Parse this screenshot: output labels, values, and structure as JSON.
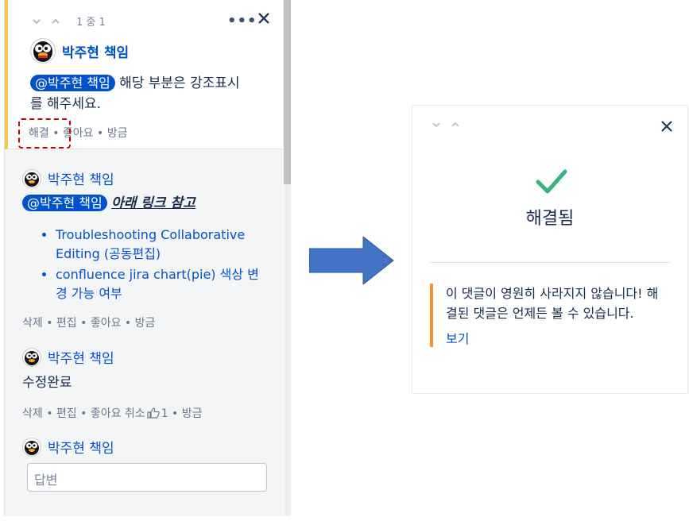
{
  "active_comment": {
    "counter": "1 중 1",
    "author": "박주현 책임",
    "mention": "@박주현 책임",
    "body": "해당 부분은 강조표시",
    "body_line2": "를 해주세요.",
    "actions": "해결 • 좋아요 • 방금"
  },
  "replies": [
    {
      "author": "박주현 책임",
      "mention": "@박주현 책임",
      "text": "아래 링크 참고",
      "links": [
        "Troubleshooting Collaborative Editing (공동편집)",
        "confluence jira chart(pie) 색상 변경 가능 여부"
      ],
      "actions": "삭제 • 편집 • 좋아요 • 방금"
    },
    {
      "author": "박주현 책임",
      "text": "수정완료",
      "actions_before": "삭제 • 편집 • 좋아요 취소",
      "actions_after": "1 • 방금"
    }
  ],
  "reply_box": {
    "author": "박주현 책임",
    "placeholder": "답변"
  },
  "resolved_panel": {
    "title": "해결됨",
    "notice": "이 댓글이 영원히 사라지지 않습니다! 해결된 댓글은 언제든 볼 수 있습니다.",
    "view_link": "보기"
  },
  "colors": {
    "accent_blue": "#0052cc",
    "highlight_yellow": "#f2c94c",
    "notice_orange": "#f79232",
    "success_green": "#36b37e",
    "arrow_blue": "#4472c4"
  },
  "icons": [
    "chevron-down-icon",
    "chevron-up-icon",
    "more-icon",
    "close-icon",
    "check-icon",
    "thumbs-up-icon",
    "penguin-avatar"
  ]
}
